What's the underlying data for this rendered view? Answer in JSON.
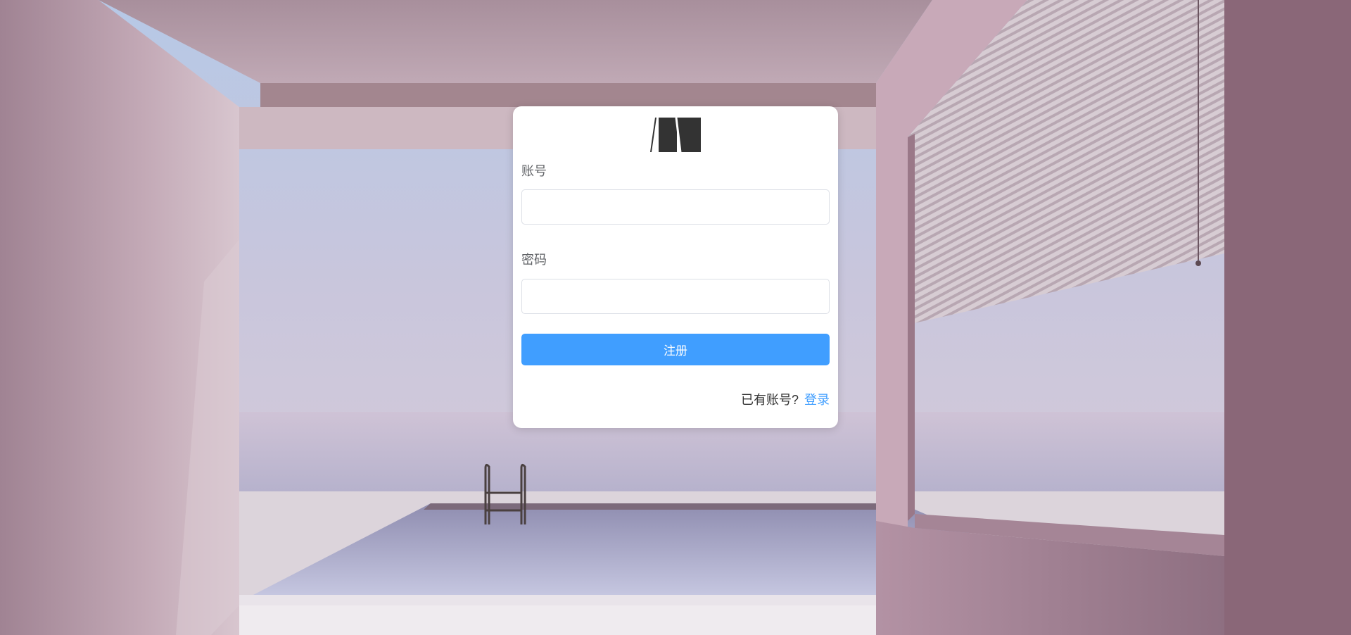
{
  "form": {
    "account_label": "账号",
    "account_value": "",
    "password_label": "密码",
    "password_value": "",
    "register_button": "注册",
    "have_account_text": "已有账号?",
    "login_link": "登录"
  },
  "colors": {
    "primary": "#409eff",
    "card_background": "#ffffff",
    "label_text": "#606266"
  },
  "icons": {
    "logo": "medium-m-logo"
  }
}
